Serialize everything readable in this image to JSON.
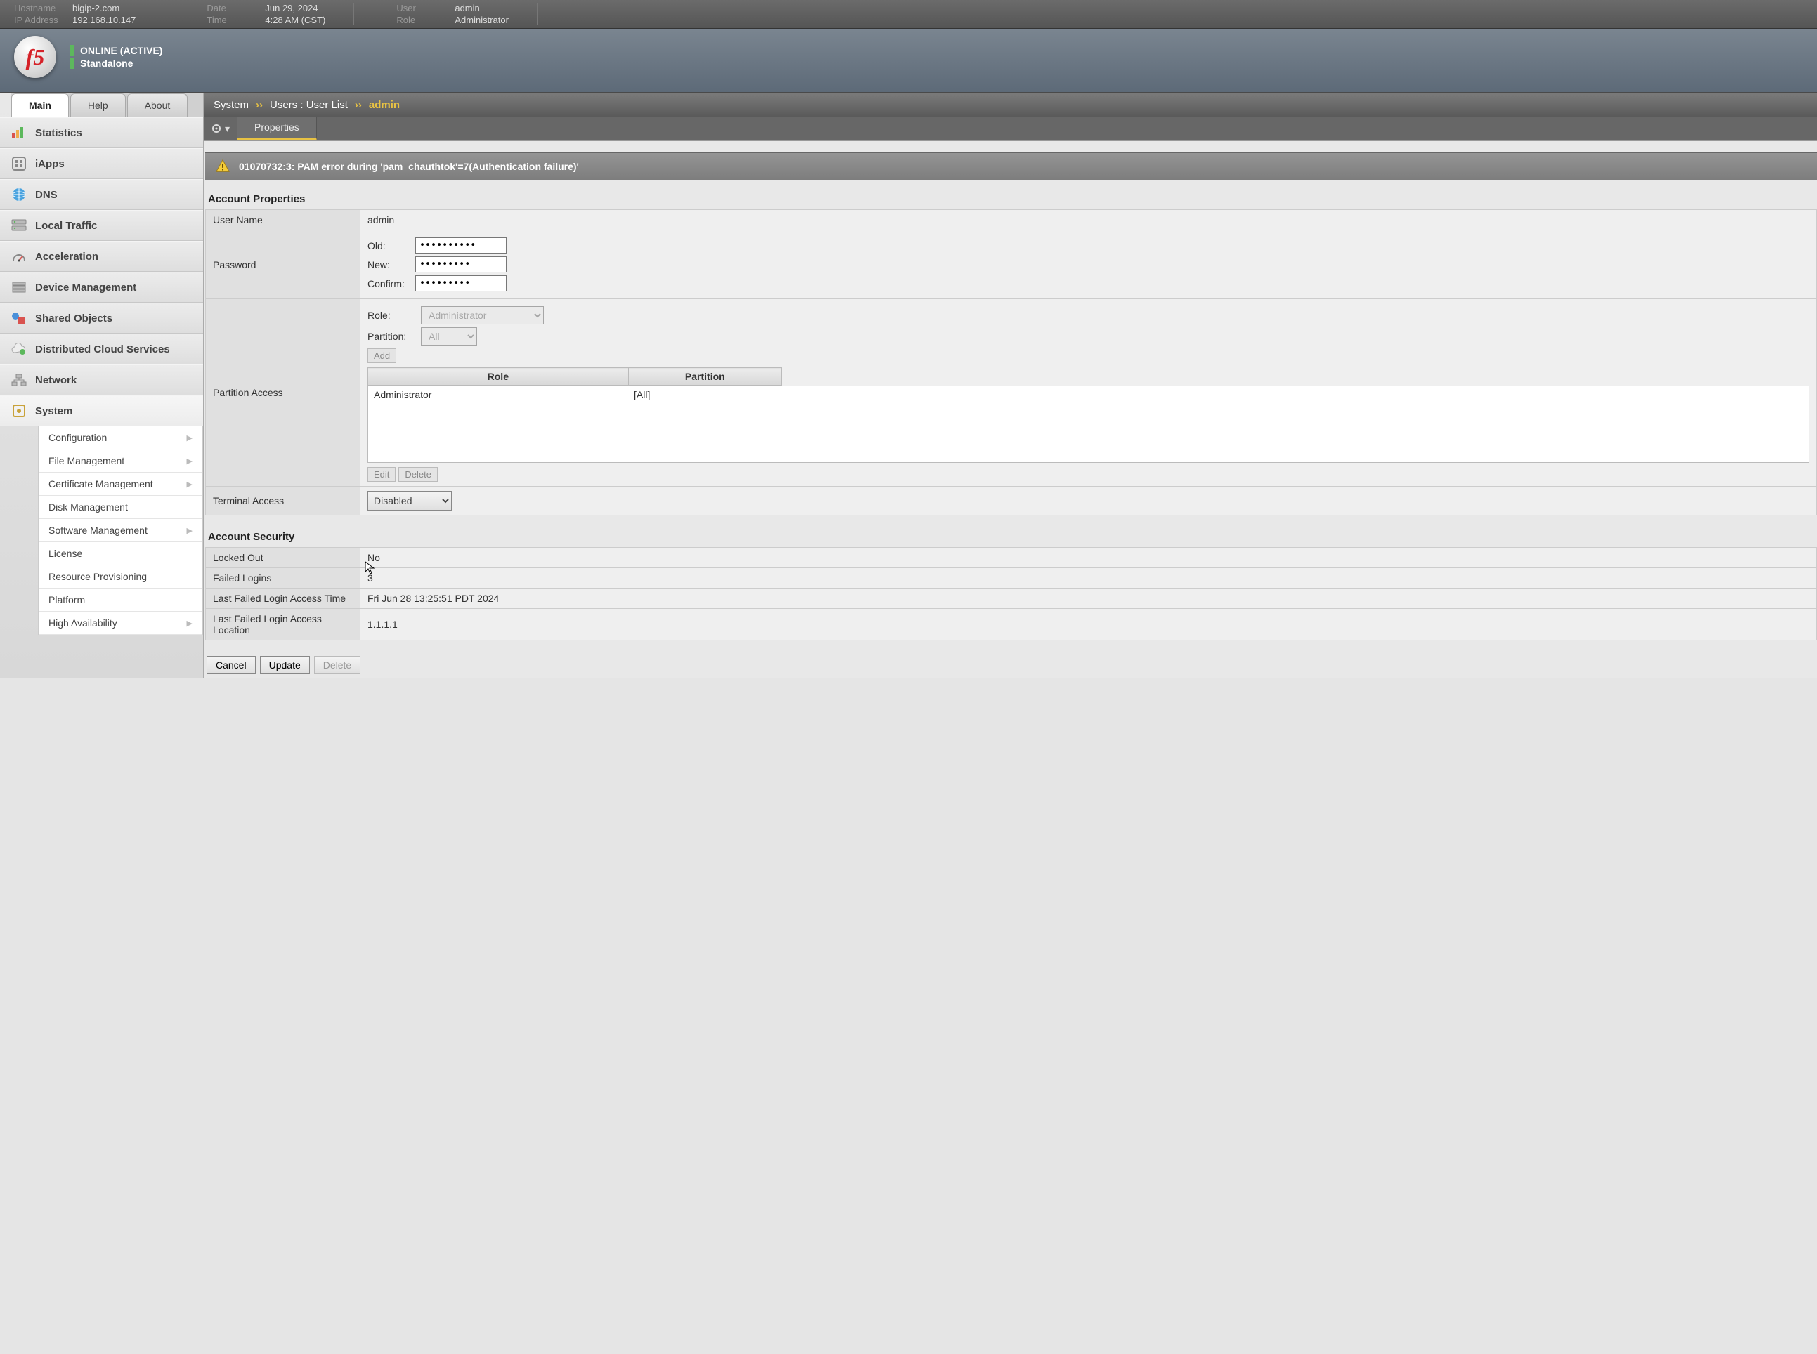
{
  "topbar": {
    "hostname_label": "Hostname",
    "hostname": "bigip-2.com",
    "ip_label": "IP Address",
    "ip": "192.168.10.147",
    "date_label": "Date",
    "date": "Jun 29, 2024",
    "time_label": "Time",
    "time": "4:28 AM (CST)",
    "user_label": "User",
    "user": "admin",
    "role_label": "Role",
    "role": "Administrator"
  },
  "banner": {
    "status": "ONLINE (ACTIVE)",
    "mode": "Standalone",
    "logo_text": "f5"
  },
  "tabs": {
    "main": "Main",
    "help": "Help",
    "about": "About"
  },
  "nav": {
    "statistics": "Statistics",
    "iapps": "iApps",
    "dns": "DNS",
    "local_traffic": "Local Traffic",
    "acceleration": "Acceleration",
    "device_mgmt": "Device Management",
    "shared_objects": "Shared Objects",
    "cloud": "Distributed Cloud Services",
    "network": "Network",
    "system": "System"
  },
  "subnav": {
    "configuration": "Configuration",
    "file_mgmt": "File Management",
    "cert_mgmt": "Certificate Management",
    "disk_mgmt": "Disk Management",
    "soft_mgmt": "Software Management",
    "license": "License",
    "res_prov": "Resource Provisioning",
    "platform": "Platform",
    "ha": "High Availability"
  },
  "breadcrumb": {
    "root": "System",
    "mid": "Users : User List",
    "final": "admin",
    "sep": "››"
  },
  "sec_tab": {
    "properties": "Properties"
  },
  "warning": "01070732:3: PAM error during 'pam_chauthtok'=7(Authentication failure)'",
  "account": {
    "title": "Account Properties",
    "username_label": "User Name",
    "username": "admin",
    "password_label": "Password",
    "old_label": "Old:",
    "new_label": "New:",
    "confirm_label": "Confirm:",
    "old_val": "••••••••••",
    "new_val": "•••••••••",
    "confirm_val": "•••••••••",
    "pa_label": "Partition Access",
    "role_label": "Role:",
    "role_val": "Administrator",
    "partition_label": "Partition:",
    "partition_val": "All",
    "add_btn": "Add",
    "th_role": "Role",
    "th_partition": "Partition",
    "row_role": "Administrator",
    "row_partition": "[All]",
    "edit_btn": "Edit",
    "del_btn": "Delete",
    "term_label": "Terminal Access",
    "term_val": "Disabled"
  },
  "security": {
    "title": "Account Security",
    "locked_label": "Locked Out",
    "locked_val": "No",
    "failed_label": "Failed Logins",
    "failed_val": "3",
    "lasttime_label": "Last Failed Login Access Time",
    "lasttime_val": "Fri Jun 28 13:25:51 PDT 2024",
    "lastloc_label": "Last Failed Login Access Location",
    "lastloc_val": "1.1.1.1"
  },
  "footer": {
    "cancel": "Cancel",
    "update": "Update",
    "delete": "Delete"
  }
}
